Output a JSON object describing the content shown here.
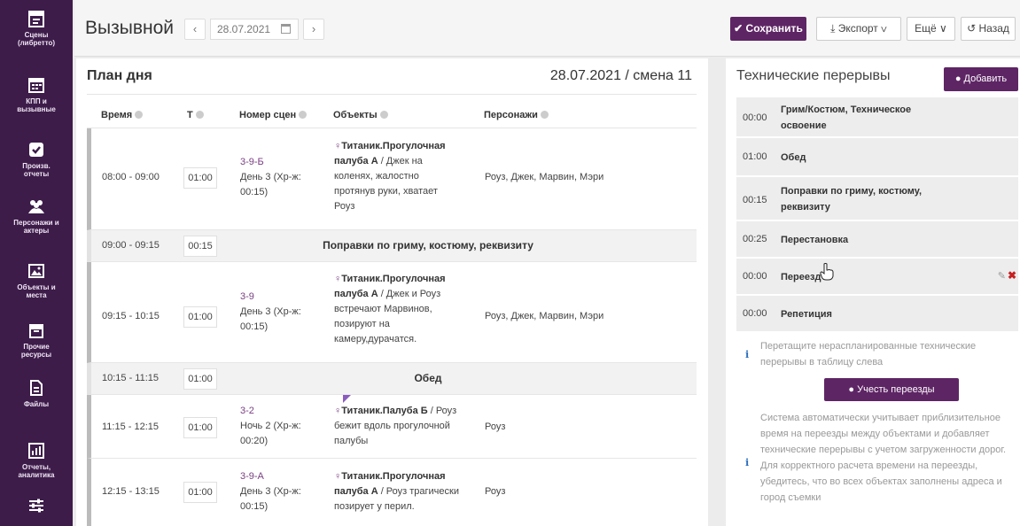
{
  "sidebar": {
    "items": [
      {
        "label1": "Сцены",
        "label2": "(либретто)",
        "icon": "clapperboard-icon"
      },
      {
        "label1": "КПП и",
        "label2": "вызывные",
        "icon": "calendar-icon"
      },
      {
        "label1": "Произв.",
        "label2": "отчеты",
        "icon": "checkbox-icon"
      },
      {
        "label1": "Персонажи и",
        "label2": "актеры",
        "icon": "people-icon"
      },
      {
        "label1": "Объекты и",
        "label2": "места",
        "icon": "image-icon"
      },
      {
        "label1": "Прочие",
        "label2": "ресурсы",
        "icon": "box-icon"
      },
      {
        "label1": "Файлы",
        "label2": "",
        "icon": "file-icon"
      },
      {
        "label1": "Отчеты,",
        "label2": "аналитика",
        "icon": "chart-icon"
      },
      {
        "label1": "",
        "label2": "",
        "icon": "sliders-icon"
      }
    ]
  },
  "header": {
    "title": "Вызывной",
    "prev": "‹",
    "date": "28.07.2021",
    "next": "›",
    "save": "✔ Сохранить",
    "export": "⤓ Экспорт ∨",
    "more": "Ещё ∨",
    "back": "↺ Назад"
  },
  "plan": {
    "title": "План дня",
    "date_shift": "28.07.2021 / смена 11",
    "columns": {
      "time": "Время",
      "t": "Т",
      "scene_no": "Номер сцен",
      "objects": "Объекты",
      "characters": "Персонажи"
    },
    "rows": [
      {
        "time": "08:00 - 09:00",
        "t": "01:00",
        "scene1": "3-9-Б",
        "scene2": "День 3 (Хр-ж:",
        "scene3": "00:15)",
        "obj1": "Титаник.Прогулочная",
        "obj2": "палуба А",
        "obj2b": " / Джек на",
        "obj3": "коленях, жалостно",
        "obj4": "протянув руки, хватает",
        "obj5": "Роуз",
        "characters": "Роуз, Джек, Марвин, Мэри"
      },
      {
        "time": "09:00 - 09:15",
        "t": "00:15",
        "label": "Поправки по гриму, костюму, реквизиту"
      },
      {
        "time": "09:15 - 10:15",
        "t": "01:00",
        "scene1": "3-9",
        "scene2": "День 3 (Хр-ж:",
        "scene3": "00:15)",
        "obj1": "Титаник.Прогулочная",
        "obj2": "палуба А",
        "obj2b": " / Джек и Роуз",
        "obj3": "встречают Марвинов,",
        "obj4": "позируют на",
        "obj5": "камеру,дурачатся.",
        "characters": "Роуз, Джек, Марвин, Мэри"
      },
      {
        "time": "10:15 - 11:15",
        "t": "01:00",
        "label": "Обед"
      },
      {
        "time": "11:15 - 12:15",
        "t": "01:00",
        "scene1": "3-2",
        "scene2": "Ночь 2 (Хр-ж:",
        "scene3": "00:20)",
        "obj1": "Титаник.Палуба Б",
        "obj1b": " / Роуз",
        "obj2": "бежит вдоль прогулочной",
        "obj3": "палубы",
        "characters": "Роуз"
      },
      {
        "time": "12:15 - 13:15",
        "t": "01:00",
        "scene1": "3-9-А",
        "scene2": "День 3 (Хр-ж:",
        "scene3": "00:15)",
        "obj1": "Титаник.Прогулочная",
        "obj2": "палуба А",
        "obj2b": " / Роуз трагически",
        "obj3": "позирует у перил.",
        "characters": "Роуз"
      }
    ]
  },
  "breaks": {
    "title": "Технические перерывы",
    "add": "Добавить",
    "items": [
      {
        "time": "00:00",
        "name1": "Грим/Костюм, Техническое",
        "name2": "освоение"
      },
      {
        "time": "01:00",
        "name1": "Обед"
      },
      {
        "time": "00:15",
        "name1": "Поправки по гриму, костюму,",
        "name2": "реквизиту"
      },
      {
        "time": "00:25",
        "name1": "Перестановка"
      },
      {
        "time": "00:00",
        "name1": "Переезд"
      },
      {
        "time": "00:00",
        "name1": "Репетиция"
      }
    ],
    "hint1": "Перетащите нераспланированные технические",
    "hint2": "перерывы в таблицу слева",
    "travel_button": "Учесть переезды",
    "note": [
      "Система автоматически учитывает приблизительное",
      "время на переезды между объектами и добавляет",
      "технические перерывы с учетом загруженности дорог.",
      "Для корректного расчета времени на переезды,",
      "убедитесь, что во всех объектах заполнены адреса и",
      "город съемки"
    ]
  }
}
